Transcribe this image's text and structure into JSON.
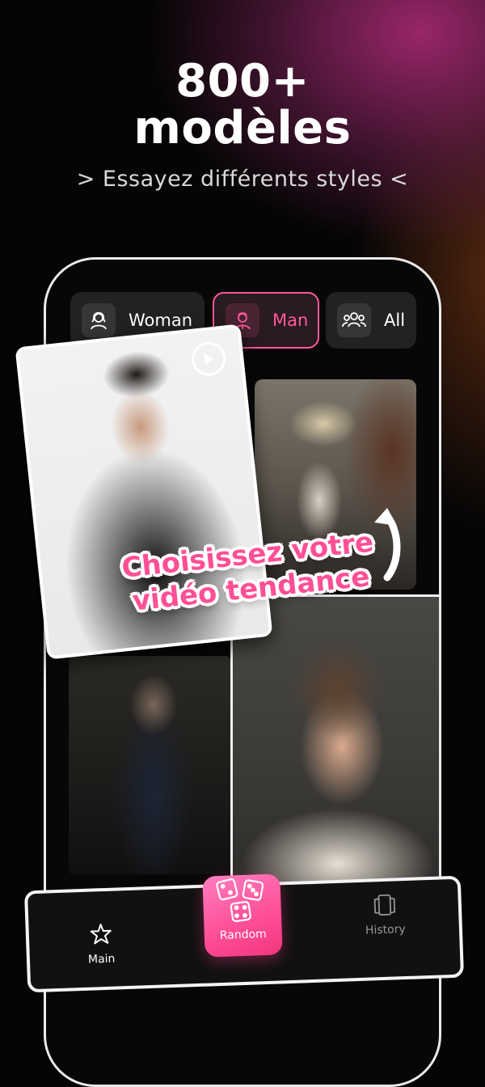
{
  "header": {
    "title_line1": "800+",
    "title_line2": "modèles",
    "subtitle": "> Essayez différents styles <"
  },
  "tabs": [
    {
      "label": "Woman",
      "icon": "woman-avatar-icon",
      "active": false
    },
    {
      "label": "Man",
      "icon": "man-avatar-icon",
      "active": true
    },
    {
      "label": "All",
      "icon": "group-icon",
      "active": false
    }
  ],
  "callout": {
    "line1": "Choisissez votre",
    "line2": "vidéo tendance"
  },
  "nav": {
    "main_label": "Main",
    "random_label": "Random",
    "history_label": "History"
  },
  "colors": {
    "accent": "#ff4f95",
    "background": "#050505",
    "glow": "#a0286e"
  }
}
